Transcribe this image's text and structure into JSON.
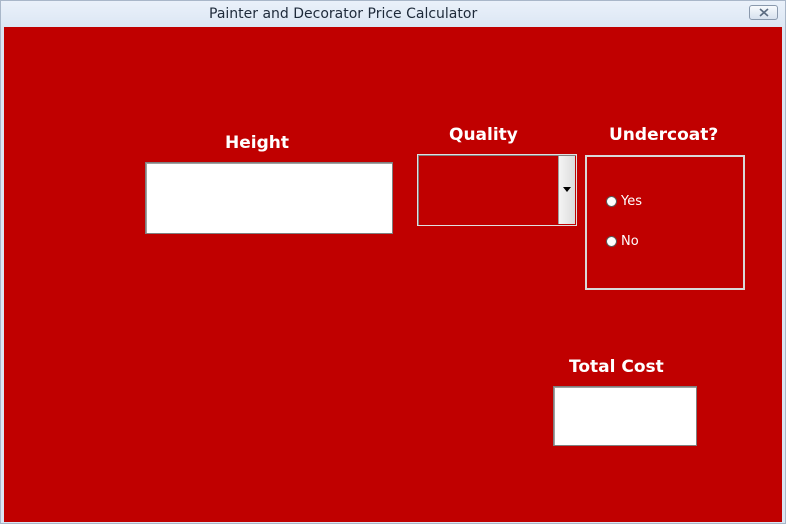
{
  "window": {
    "title": "Painter and Decorator Price Calculator"
  },
  "form": {
    "height": {
      "label": "Height",
      "value": ""
    },
    "quality": {
      "label": "Quality",
      "selected": ""
    },
    "undercoat": {
      "label": "Undercoat?",
      "options": [
        {
          "label": "Yes",
          "checked": false
        },
        {
          "label": "No",
          "checked": false
        }
      ]
    },
    "total_cost": {
      "label": "Total Cost",
      "value": ""
    }
  },
  "colors": {
    "form_background": "#c00000",
    "label_text": "#ffffff",
    "field_background": "#ffffff"
  },
  "icons": {
    "close": "close-icon",
    "dropdown": "dropdown-arrow-icon"
  }
}
